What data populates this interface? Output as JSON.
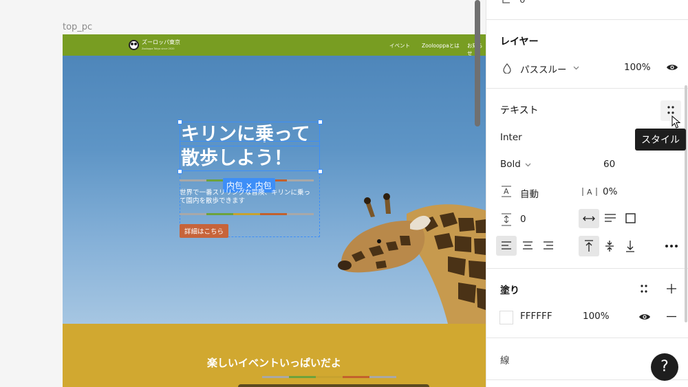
{
  "canvas": {
    "frame_label": "top_pc",
    "site": {
      "name": "ズーロッパ東京",
      "tagline": "Zooloppa Tokyo since 2020",
      "nav": [
        "イベント",
        "Zoolooppaとは",
        "お知らせ"
      ],
      "headline": "キリンに乗って\n散歩しよう！",
      "selection_badge": "内包 × 内包",
      "hero_sub": "世界で一番スリリングな冒険、キリンに乗って園内を散歩できます",
      "cta": "詳細はこちら",
      "section_title": "楽しいイベントいっぱいだよ",
      "stripe_colors": [
        "#a8a8a8",
        "#6da23c",
        "#c7a22f",
        "#c2612d",
        "#a8a8a8"
      ]
    }
  },
  "panel": {
    "layer": {
      "title": "レイヤー",
      "blend_mode": "パススルー",
      "opacity": "100%"
    },
    "text": {
      "title": "テキスト",
      "font_family": "Inter",
      "font_weight": "Bold",
      "font_size": "60",
      "line_height": "自動",
      "letter_spacing": "0%",
      "paragraph_spacing": "0"
    },
    "tooltip": "スタイル",
    "fill": {
      "title": "塗り",
      "hex": "FFFFFF",
      "opacity": "100%"
    },
    "stroke": {
      "title": "線"
    },
    "top_value": "0",
    "help": "?"
  }
}
